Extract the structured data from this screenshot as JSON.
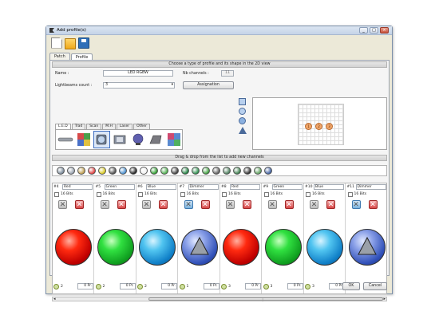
{
  "window": {
    "title": "Add profile(s)",
    "minimize_label": "_",
    "maximize_label": "□",
    "close_label": "×"
  },
  "tabs": [
    {
      "label": "Patch"
    },
    {
      "label": "Profile",
      "active": true
    }
  ],
  "profile_section": {
    "header": "Choose a type of profile and its shape in the 2D view",
    "name_label": "Name :",
    "name_value": "LED RGBW",
    "nb_channels_label": "Nb channels :",
    "nb_channels_value": "11",
    "lightbeams_label": "Lightbeams count :",
    "lightbeams_value": "3",
    "lightbeams_arrow": "▾",
    "assignation_button": "Assignation",
    "lamp_tabs": [
      "L.E.D",
      "Trad",
      "Scan",
      "M.H",
      "Laser",
      "Other"
    ],
    "active_lamp_tab": "L.E.D",
    "lamps": [
      "led-bar",
      "led-panel-rgb",
      "led-par",
      "led-flood",
      "led-spot",
      "led-dome",
      "led-panel-square"
    ],
    "shapes": [
      "square",
      "circle",
      "circle-alt",
      "triangle"
    ],
    "preview_dots": [
      "1",
      "2",
      "3"
    ]
  },
  "channel_section": {
    "header": "Drag & drop from the list to add new channels",
    "palette_colors": [
      "#7a8a9a",
      "#9aa4b0",
      "#c0a050",
      "#e04040",
      "#d8c820",
      "#505050",
      "#4a90d0",
      "#202020",
      "#f0f0f0",
      "#30a030",
      "#50b050",
      "#404040",
      "#208040",
      "#309050",
      "#40a040",
      "#606060",
      "#508060",
      "#408050",
      "#303030",
      "#60a060",
      "#4060a0"
    ]
  },
  "channels": [
    {
      "num": "#4",
      "name": "Red",
      "bits": "16 Bits",
      "type": "red",
      "delay_icon": "2",
      "value": "0 Pr.",
      "edit_style": "grey"
    },
    {
      "num": "#5",
      "name": "Green",
      "bits": "16 Bits",
      "type": "green",
      "delay_icon": "2",
      "value": "0 Pr.",
      "edit_style": "grey"
    },
    {
      "num": "#6",
      "name": "Blue",
      "bits": "16 Bits",
      "type": "blue",
      "delay_icon": "2",
      "value": "0 Pr.",
      "edit_style": "grey"
    },
    {
      "num": "#7",
      "name": "Dimmer",
      "bits": "16 Bits",
      "type": "dimmer",
      "delay_icon": "1",
      "value": "0 Pr.",
      "edit_style": "blue"
    },
    {
      "num": "#8",
      "name": "Red",
      "bits": "16 Bits",
      "type": "red",
      "delay_icon": "3",
      "value": "0 Pr.",
      "edit_style": "grey"
    },
    {
      "num": "#9",
      "name": "Green",
      "bits": "16 Bits",
      "type": "green",
      "delay_icon": "3",
      "value": "0 Pr.",
      "edit_style": "grey"
    },
    {
      "num": "#10",
      "name": "Blue",
      "bits": "16 Bits",
      "type": "blue",
      "delay_icon": "3",
      "value": "0 Pr.",
      "edit_style": "grey"
    },
    {
      "num": "#11",
      "name": "Dimmer",
      "bits": "16 Bits",
      "type": "dimmer",
      "delay_icon": "2",
      "value": "0 Pr.",
      "edit_style": "blue"
    }
  ],
  "scrollbar": {
    "left_arrow": "◂",
    "right_arrow": "▸",
    "grip": "⋮"
  },
  "footer": {
    "ok": "OK",
    "cancel": "Cancel"
  }
}
